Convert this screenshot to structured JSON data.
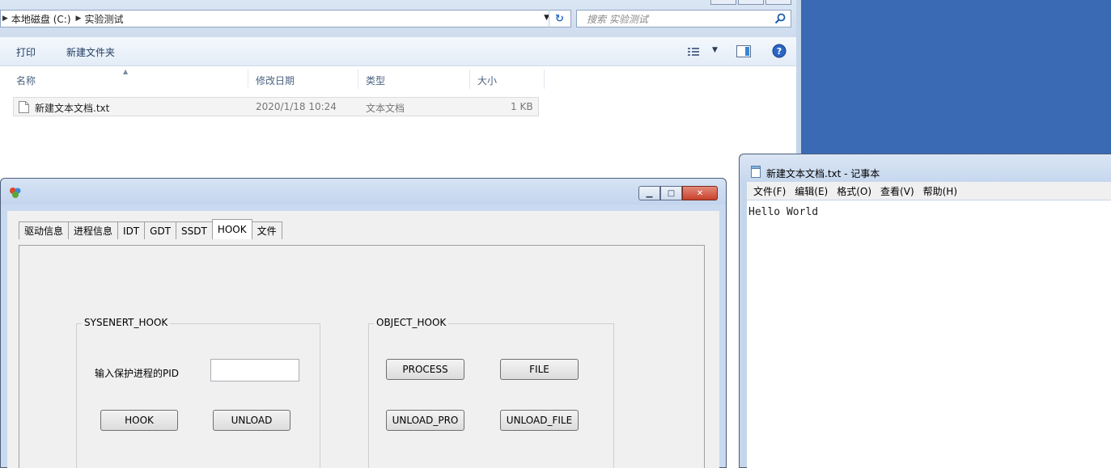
{
  "explorer": {
    "breadcrumb": [
      "本地磁盘 (C:)",
      "实验测试"
    ],
    "search_placeholder": "搜索 实验测试",
    "toolbar": {
      "print": "打印",
      "new_folder": "新建文件夹"
    },
    "columns": {
      "name": "名称",
      "modified": "修改日期",
      "type": "类型",
      "size": "大小"
    },
    "files": [
      {
        "name": "新建文本文档.txt",
        "modified": "2020/1/18 10:24",
        "type": "文本文档",
        "size": "1 KB"
      }
    ]
  },
  "toolwin": {
    "tabs": [
      "驱动信息",
      "进程信息",
      "IDT",
      "GDT",
      "SSDT",
      "HOOK",
      "文件"
    ],
    "active_tab": "HOOK",
    "sysenter_group": {
      "title": "SYSENERT_HOOK",
      "pid_label": "输入保护进程的PID",
      "pid_value": "",
      "hook_button": "HOOK",
      "unload_button": "UNLOAD"
    },
    "object_group": {
      "title": "OBJECT_HOOK",
      "process_button": "PROCESS",
      "file_button": "FILE",
      "unload_pro_button": "UNLOAD_PRO",
      "unload_file_button": "UNLOAD_FILE"
    }
  },
  "notepad": {
    "title": "新建文本文档.txt - 记事本",
    "menus": [
      "文件(F)",
      "编辑(E)",
      "格式(O)",
      "查看(V)",
      "帮助(H)"
    ],
    "content": "Hello World"
  },
  "colors": {
    "desktop": "#3a6ab3",
    "window_frame": "#c5d6ea",
    "close_button": "#c8412b"
  }
}
